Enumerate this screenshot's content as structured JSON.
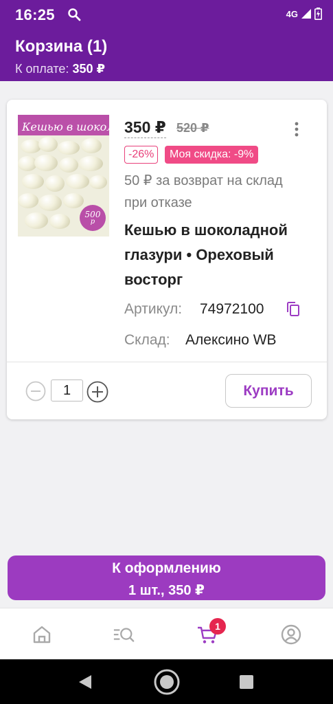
{
  "status_bar": {
    "time": "16:25",
    "network": "4G"
  },
  "header": {
    "title": "Корзина (1)",
    "to_pay_label": "К оплате:",
    "to_pay_value": "350 ₽"
  },
  "product": {
    "image_title": "Кешью в шоколаде",
    "image_price_tag_number": "500",
    "image_price_tag_currency": "р",
    "price_now": "350 ₽",
    "price_old": "520 ₽",
    "discount_badge": "-26%",
    "my_discount_badge": "Моя скидка: -9%",
    "return_info": "50 ₽ за возврат на склад при отказе",
    "name": "Кешью в шоколадной глазури • Ореховый восторг",
    "article_label": "Артикул:",
    "article_value": "74972100",
    "warehouse_label": "Склад:",
    "warehouse_value": "Алексино WB",
    "quantity": "1",
    "buy_label": "Купить"
  },
  "checkout": {
    "title": "К оформлению",
    "summary": "1 шт., 350 ₽"
  },
  "bottom_nav": {
    "items": [
      {
        "icon": "home-icon"
      },
      {
        "icon": "catalog-search-icon"
      },
      {
        "icon": "cart-icon",
        "badge": "1"
      },
      {
        "icon": "profile-icon"
      }
    ]
  },
  "colors": {
    "brand": "#6c1c9c",
    "accent": "#9c3bc0",
    "discount": "#f04b86",
    "badge": "#e5264f"
  }
}
